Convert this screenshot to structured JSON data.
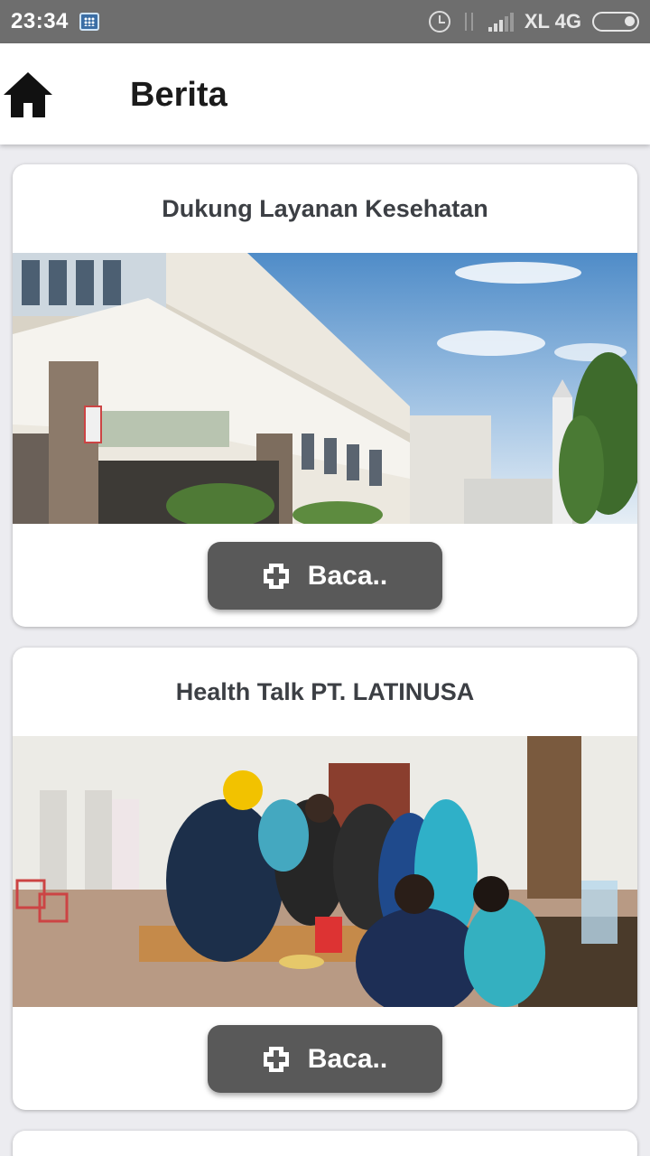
{
  "status_bar": {
    "time": "23:34",
    "network": "XL 4G",
    "icons": [
      "bbm-icon",
      "alarm-icon",
      "data-icon",
      "signal-icon",
      "battery-icon"
    ]
  },
  "app_bar": {
    "title": "Berita",
    "icon": "home-icon"
  },
  "news": [
    {
      "title": "Dukung Layanan Kesehatan",
      "image_description_icon": "hospital-building-photo",
      "button_label": "Baca..",
      "button_icon": "plus-box-icon"
    },
    {
      "title": "Health Talk PT. LATINUSA",
      "image_description_icon": "health-talk-event-photo",
      "button_label": "Baca..",
      "button_icon": "plus-box-icon"
    }
  ],
  "colors": {
    "status_bar": "#6e6e6e",
    "button": "#595959",
    "background": "#ececf0"
  }
}
